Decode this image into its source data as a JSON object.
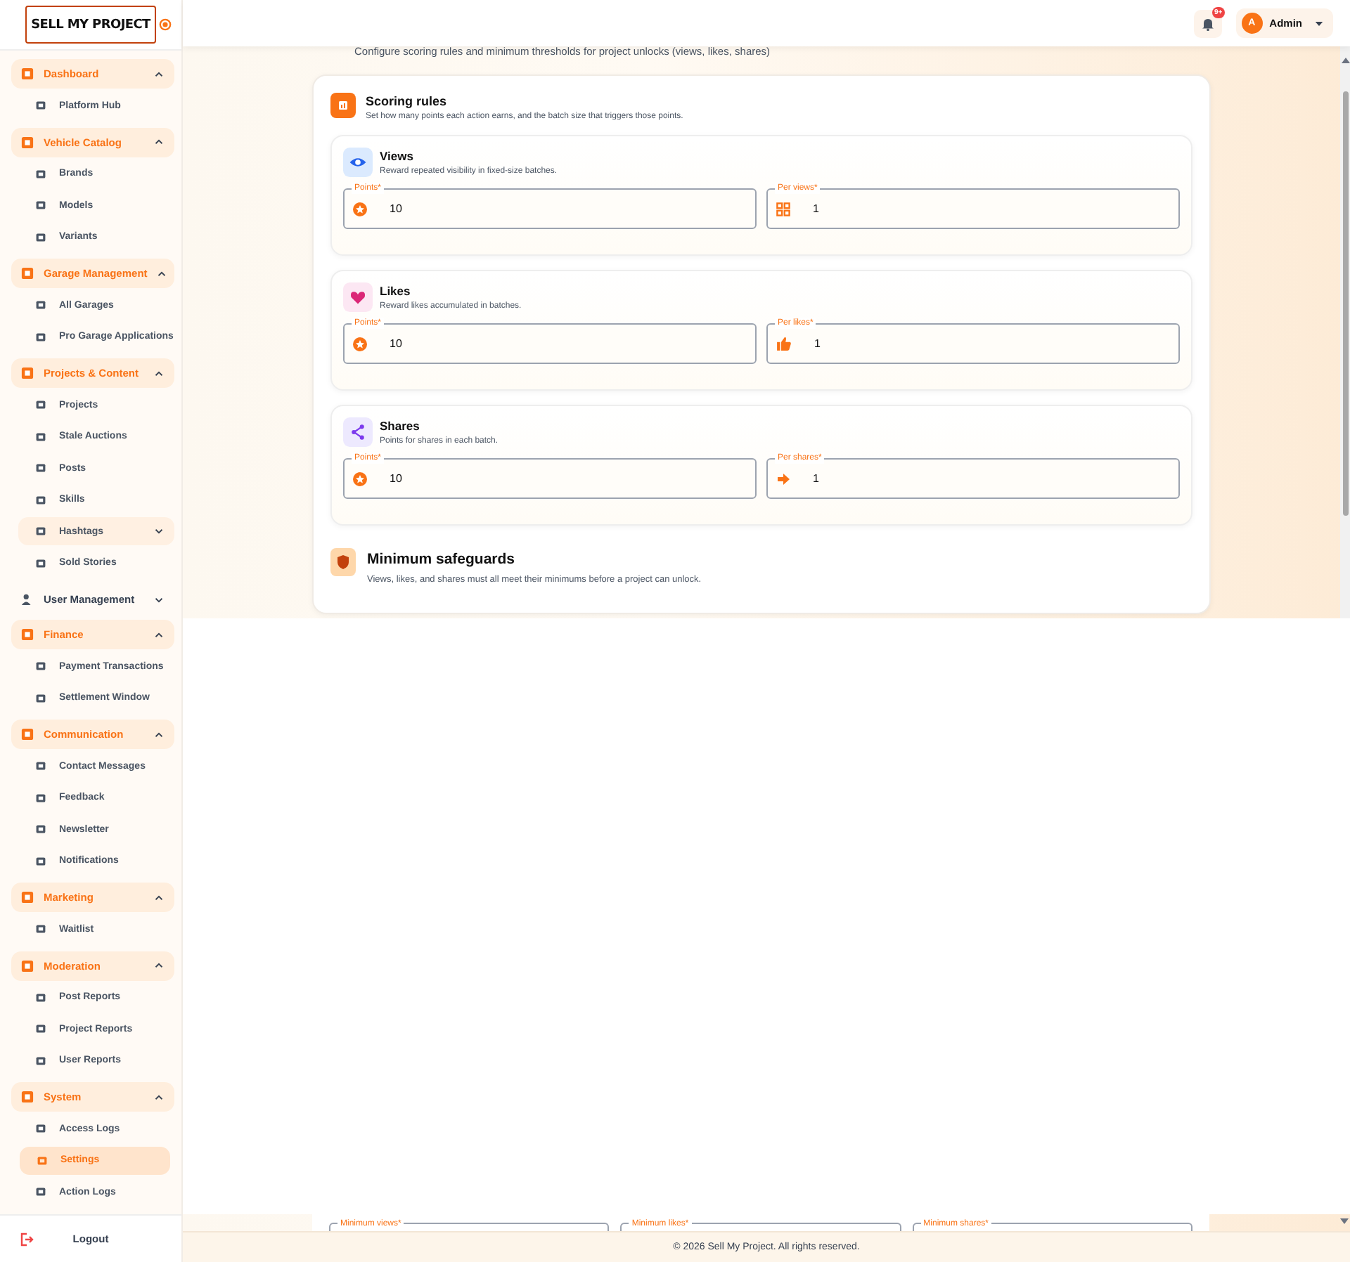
{
  "sidebar": {
    "logo": {
      "title": "SELL MY PROJECT"
    },
    "groups": [
      {
        "label": "Dashboard",
        "expanded": true,
        "items": [
          {
            "label": "Platform Hub",
            "kind": "link",
            "selected": false
          }
        ]
      },
      {
        "label": "Vehicle Catalog",
        "expanded": true,
        "items": [
          {
            "label": "Brands",
            "kind": "link",
            "selected": false
          },
          {
            "label": "Models",
            "kind": "link",
            "selected": false
          },
          {
            "label": "Variants",
            "kind": "link",
            "selected": false
          }
        ]
      },
      {
        "label": "Garage Management",
        "expanded": true,
        "items": [
          {
            "label": "All Garages",
            "kind": "link",
            "selected": false
          },
          {
            "label": "Pro Garage Applications",
            "kind": "link",
            "selected": false
          }
        ]
      },
      {
        "label": "Projects & Content",
        "expanded": true,
        "items": [
          {
            "label": "Projects",
            "kind": "link",
            "selected": false
          },
          {
            "label": "Stale Auctions",
            "kind": "link",
            "selected": false
          },
          {
            "label": "Posts",
            "kind": "link",
            "selected": false
          },
          {
            "label": "Skills",
            "kind": "link",
            "selected": false
          },
          {
            "label": "Hashtags",
            "kind": "submenu",
            "expanded": false,
            "selected": false
          },
          {
            "label": "Sold Stories",
            "kind": "link",
            "selected": false
          }
        ]
      },
      {
        "label": "User Management",
        "expanded": false
      },
      {
        "label": "Finance",
        "expanded": true,
        "items": [
          {
            "label": "Payment Transactions",
            "kind": "link",
            "selected": false
          },
          {
            "label": "Settlement Window",
            "kind": "link",
            "selected": false
          }
        ]
      },
      {
        "label": "Communication",
        "expanded": true,
        "items": [
          {
            "label": "Contact Messages",
            "kind": "link",
            "selected": false
          },
          {
            "label": "Feedback",
            "kind": "link",
            "selected": false
          },
          {
            "label": "Newsletter",
            "kind": "link",
            "selected": false
          },
          {
            "label": "Notifications",
            "kind": "link",
            "selected": false
          }
        ]
      },
      {
        "label": "Marketing",
        "expanded": true,
        "items": [
          {
            "label": "Waitlist",
            "kind": "link",
            "selected": false
          }
        ]
      },
      {
        "label": "Moderation",
        "expanded": true,
        "items": [
          {
            "label": "Post Reports",
            "kind": "link",
            "selected": false
          },
          {
            "label": "Project Reports",
            "kind": "link",
            "selected": false
          },
          {
            "label": "User Reports",
            "kind": "link",
            "selected": false
          }
        ]
      },
      {
        "label": "System",
        "expanded": true,
        "items": [
          {
            "label": "Access Logs",
            "kind": "link",
            "selected": false
          },
          {
            "label": "Settings",
            "kind": "link",
            "selected": true
          },
          {
            "label": "Action Logs",
            "kind": "link",
            "selected": false
          }
        ]
      }
    ],
    "logout": "Logout"
  },
  "header": {
    "notification_badge": "9+",
    "user": {
      "initial": "A",
      "name": "Admin"
    }
  },
  "page": {
    "subtitle": "Configure scoring rules and minimum thresholds for project unlocks (views, likes, shares)",
    "scoring": {
      "title": "Scoring rules",
      "description": "Set how many points each action earns, and the batch size that triggers those points.",
      "rules": [
        {
          "kind": "views",
          "title": "Views",
          "description": "Reward repeated visibility in fixed-size batches.",
          "fields": [
            {
              "label": "Points*",
              "value": "10"
            },
            {
              "label": "Per views*",
              "value": "1"
            }
          ]
        },
        {
          "kind": "likes",
          "title": "Likes",
          "description": "Reward likes accumulated in batches.",
          "fields": [
            {
              "label": "Points*",
              "value": "10"
            },
            {
              "label": "Per likes*",
              "value": "1"
            }
          ]
        },
        {
          "kind": "shares",
          "title": "Shares",
          "description": "Points for shares in each batch.",
          "fields": [
            {
              "label": "Points*",
              "value": "10"
            },
            {
              "label": "Per shares*",
              "value": "1"
            }
          ]
        }
      ]
    },
    "safeguards": {
      "title": "Minimum safeguards",
      "description": "Views, likes, and shares must all meet their minimums before a project can unlock.",
      "fields": [
        {
          "label": "Minimum views*"
        },
        {
          "label": "Minimum likes*"
        },
        {
          "label": "Minimum shares*"
        }
      ]
    }
  },
  "footer": "© 2026 Sell My Project. All rights reserved."
}
